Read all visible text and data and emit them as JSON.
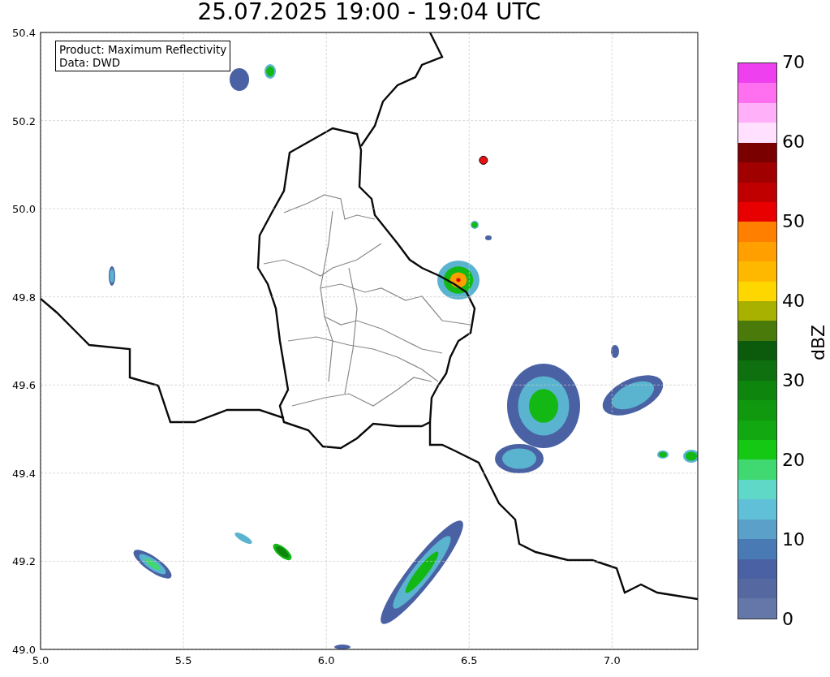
{
  "title": "25.07.2025 19:00 - 19:04 UTC",
  "info_box": {
    "lines": [
      "Product: Maximum Reflectivity",
      "Data: DWD"
    ]
  },
  "map": {
    "chart_data": {
      "type": "scatter",
      "xlim": [
        5.0,
        7.3
      ],
      "ylim": [
        49.0,
        50.4
      ],
      "xticks": [
        {
          "value": 5.0,
          "label": "5.0"
        },
        {
          "value": 5.5,
          "label": "5.5"
        },
        {
          "value": 6.0,
          "label": "6.0"
        },
        {
          "value": 6.5,
          "label": "6.5"
        },
        {
          "value": 7.0,
          "label": "7.0"
        }
      ],
      "yticks": [
        {
          "value": 49.0,
          "label": "49.0"
        },
        {
          "value": 49.2,
          "label": "49.2"
        },
        {
          "value": 49.4,
          "label": "49.4"
        },
        {
          "value": 49.6,
          "label": "49.6"
        },
        {
          "value": 49.8,
          "label": "49.8"
        },
        {
          "value": 50.0,
          "label": "50.0"
        },
        {
          "value": 50.2,
          "label": "50.2"
        },
        {
          "value": 50.4,
          "label": "50.4"
        }
      ],
      "x": [
        6.55
      ],
      "grid": true,
      "series": [
        {
          "color": "#e81010",
          "values": [
            50.11
          ]
        }
      ]
    }
  },
  "colorbar": {
    "label": "dBZ",
    "ticks": [
      "70",
      "60",
      "50",
      "40",
      "30",
      "20",
      "10",
      "0"
    ],
    "bands": [
      {
        "color": "#ee40ee"
      },
      {
        "color": "#ff70f0"
      },
      {
        "color": "#ffb0f8"
      },
      {
        "color": "#ffe0ff"
      },
      {
        "color": "#7a0000"
      },
      {
        "color": "#a00000"
      },
      {
        "color": "#c00000"
      },
      {
        "color": "#e80000"
      },
      {
        "color": "#ff8000"
      },
      {
        "color": "#ffa000"
      },
      {
        "color": "#ffb800"
      },
      {
        "color": "#ffd700"
      },
      {
        "color": "#a8b000"
      },
      {
        "color": "#4a7a0a"
      },
      {
        "color": "#0c5a0c"
      },
      {
        "color": "#0e700e"
      },
      {
        "color": "#0e860e"
      },
      {
        "color": "#10980e"
      },
      {
        "color": "#12a812"
      },
      {
        "color": "#14c814"
      },
      {
        "color": "#40d870"
      },
      {
        "color": "#60d8c8"
      },
      {
        "color": "#60c0d8"
      },
      {
        "color": "#5aa0c8"
      },
      {
        "color": "#4a7ab4"
      },
      {
        "color": "#4a62a4"
      },
      {
        "color": "#5568a0"
      },
      {
        "color": "#6477a8"
      }
    ]
  }
}
